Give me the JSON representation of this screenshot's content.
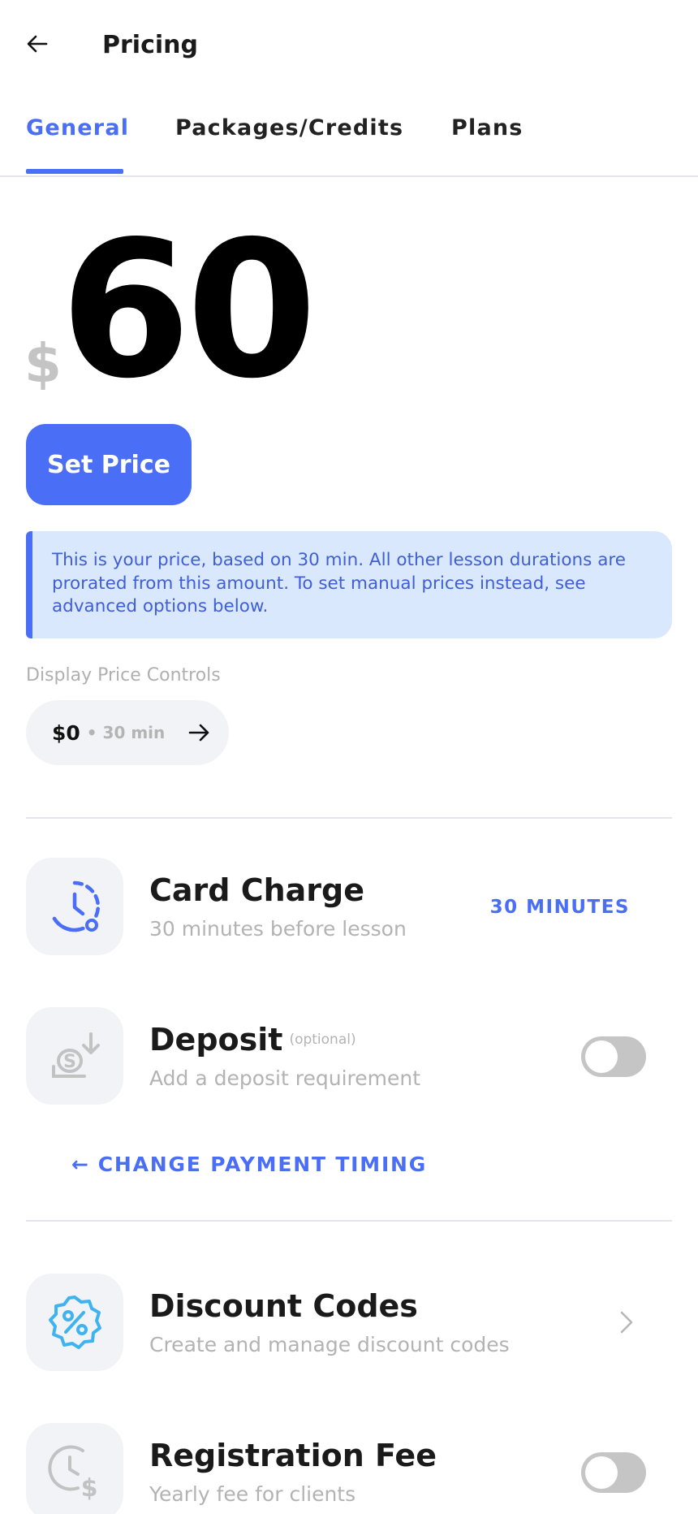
{
  "header": {
    "title": "Pricing",
    "back_icon": "arrow-left-icon"
  },
  "tabs": [
    {
      "label": "General",
      "active": true
    },
    {
      "label": "Packages/Credits",
      "active": false
    },
    {
      "label": "Plans",
      "active": false
    }
  ],
  "price": {
    "currency": "$",
    "amount": "60",
    "set_price_label": "Set Price"
  },
  "info": {
    "text": "This is your price, based on 30 min. All other lesson durations are prorated from this amount. To set manual prices instead, see advanced options below."
  },
  "display_price_controls": {
    "label": "Display Price Controls",
    "price": "$0",
    "duration": "• 30 min",
    "arrow_icon": "arrow-right-icon"
  },
  "card_charge": {
    "title": "Card Charge",
    "subtitle": "30 minutes before lesson",
    "value": "30 MINUTES",
    "icon": "clock-charge-icon"
  },
  "deposit": {
    "title": "Deposit",
    "optional": "(optional)",
    "subtitle": "Add a deposit requirement",
    "enabled": false,
    "icon": "deposit-icon"
  },
  "change_payment_timing": {
    "arrow": "←",
    "label": "CHANGE PAYMENT TIMING"
  },
  "discount_codes": {
    "title": "Discount Codes",
    "subtitle": "Create and manage discount codes",
    "icon": "discount-badge-icon"
  },
  "registration_fee": {
    "title": "Registration Fee",
    "subtitle": "Yearly fee for clients",
    "enabled": false,
    "icon": "clock-dollar-icon"
  },
  "colors": {
    "accent": "#4a6ef5",
    "info_bg": "#d9e8fc",
    "discount_icon": "#3fb3f0",
    "muted": "#b3b3b3"
  }
}
